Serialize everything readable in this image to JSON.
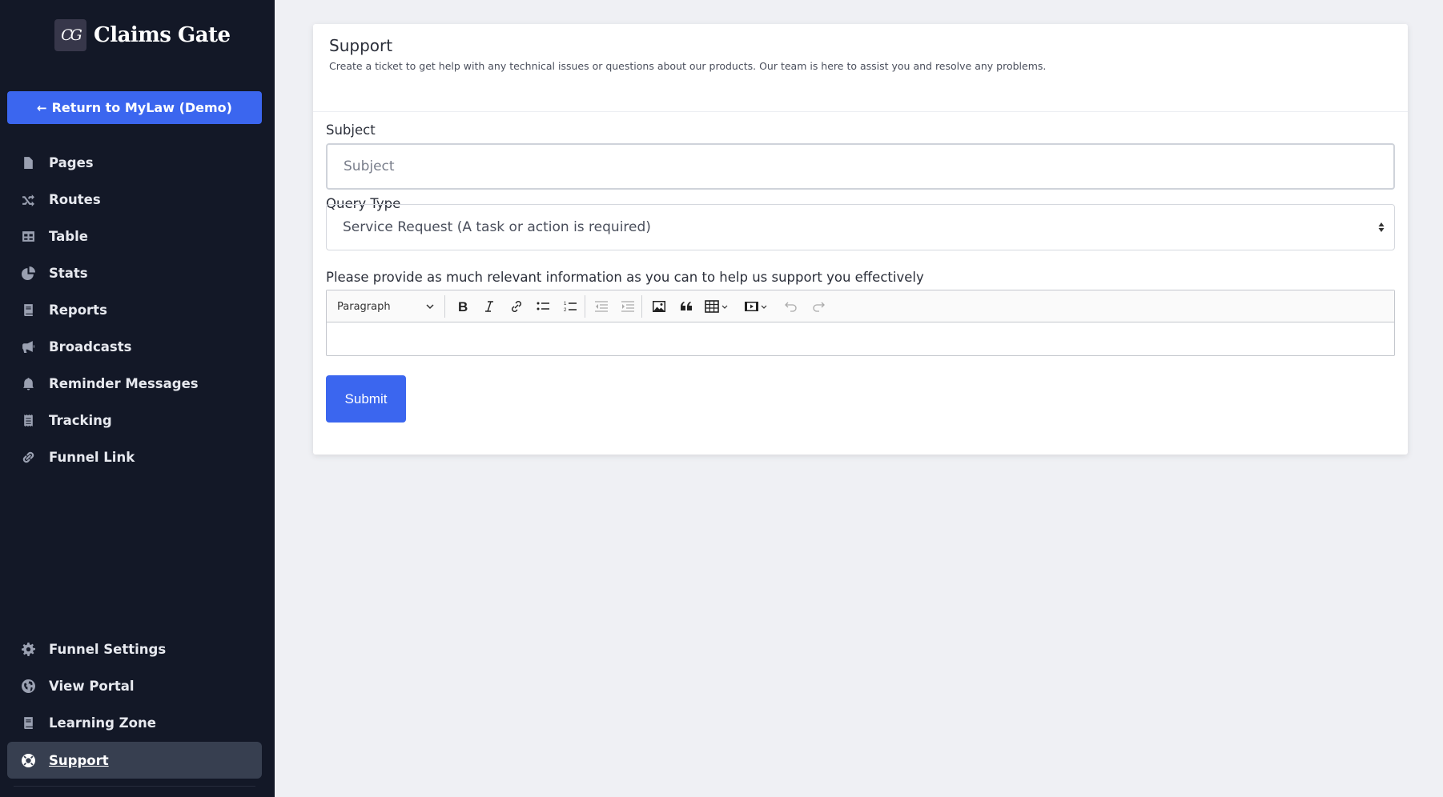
{
  "brand": {
    "logo_text": "CG",
    "name": "Claims Gate"
  },
  "sidebar": {
    "return_button": "Return to MyLaw (Demo)",
    "items": [
      {
        "label": "Pages",
        "icon": "file-icon"
      },
      {
        "label": "Routes",
        "icon": "shuffle-icon"
      },
      {
        "label": "Table",
        "icon": "table-icon"
      },
      {
        "label": "Stats",
        "icon": "pie-chart-icon"
      },
      {
        "label": "Reports",
        "icon": "book-icon"
      },
      {
        "label": "Broadcasts",
        "icon": "megaphone-icon"
      },
      {
        "label": "Reminder Messages",
        "icon": "bell-icon"
      },
      {
        "label": "Tracking",
        "icon": "receipt-icon"
      },
      {
        "label": "Funnel Link",
        "icon": "link-icon"
      }
    ],
    "bottom_items": [
      {
        "label": "Funnel Settings",
        "icon": "gear-icon"
      },
      {
        "label": "View Portal",
        "icon": "globe-icon"
      },
      {
        "label": "Learning Zone",
        "icon": "book-icon"
      },
      {
        "label": "Support",
        "icon": "lifebuoy-icon",
        "active": true
      }
    ]
  },
  "support": {
    "title": "Support",
    "subtitle": "Create a ticket to get help with any technical issues or questions about our products. Our team is here to assist you and resolve any problems.",
    "subject": {
      "label": "Subject",
      "placeholder": "Subject",
      "value": ""
    },
    "query_type": {
      "label": "Query Type",
      "selected": "Service Request (A task or action is required)"
    },
    "details": {
      "label": "Please provide as much relevant information as you can to help us support you effectively",
      "heading_select": "Paragraph",
      "toolbar": [
        "bold",
        "italic",
        "link",
        "bulleted-list",
        "numbered-list",
        "outdent",
        "indent",
        "insert-image",
        "block-quote",
        "insert-table",
        "insert-media",
        "undo",
        "redo"
      ]
    },
    "submit_label": "Submit"
  },
  "colors": {
    "sidebar_bg": "#131827",
    "accent": "#3b66ef",
    "active_item_bg": "#373f50",
    "page_bg": "#eff0f4"
  }
}
